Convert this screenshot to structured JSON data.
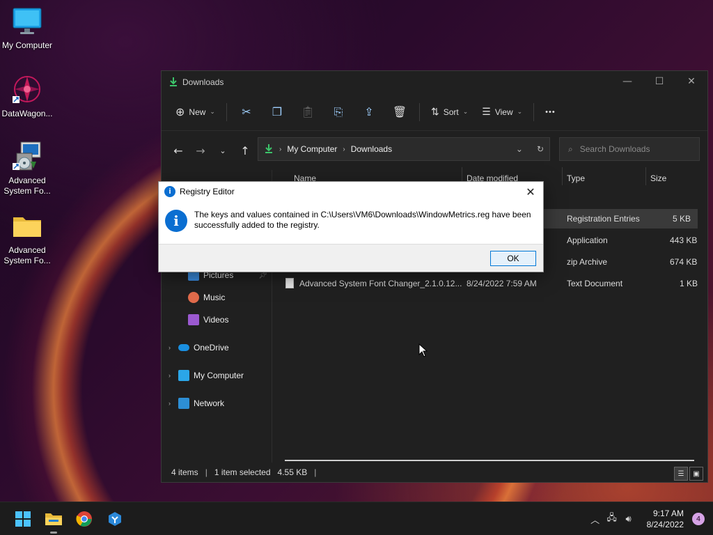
{
  "desktop": {
    "icons": [
      {
        "label": "My Computer"
      },
      {
        "label": "DataWagon..."
      },
      {
        "label": "Advanced System Fo..."
      },
      {
        "label": "Advanced System Fo..."
      }
    ]
  },
  "explorer": {
    "title": "Downloads",
    "toolbar": {
      "new_label": "New",
      "sort_label": "Sort",
      "view_label": "View",
      "more_label": "•••"
    },
    "address": {
      "crumbs": [
        "My Computer",
        "Downloads"
      ]
    },
    "search": {
      "placeholder": "Search Downloads"
    },
    "sidebar": {
      "items": [
        {
          "label": "Pictures",
          "icon": "pictures-icon"
        },
        {
          "label": "Music",
          "icon": "music-icon"
        },
        {
          "label": "Videos",
          "icon": "videos-icon"
        },
        {
          "label": "OneDrive",
          "icon": "onedrive-icon"
        },
        {
          "label": "My Computer",
          "icon": "computer-icon"
        },
        {
          "label": "Network",
          "icon": "network-icon"
        }
      ]
    },
    "columns": {
      "name": "Name",
      "date": "Date modified",
      "type": "Type",
      "size": "Size"
    },
    "files": [
      {
        "name": "",
        "date": "",
        "type": "Registration Entries",
        "size": "5 KB"
      },
      {
        "name": "",
        "date": "",
        "type": "Application",
        "size": "443 KB"
      },
      {
        "name": "",
        "date": "",
        "type": "zip Archive",
        "size": "674 KB"
      },
      {
        "name": "Advanced System Font Changer_2.1.0.12...",
        "date": "8/24/2022 7:59 AM",
        "type": "Text Document",
        "size": "1 KB"
      }
    ],
    "status": {
      "items": "4 items",
      "selected": "1 item selected",
      "size": "4.55 KB"
    }
  },
  "dialog": {
    "title": "Registry Editor",
    "message": "The keys and values contained in C:\\Users\\VM6\\Downloads\\WindowMetrics.reg have been successfully added to the registry.",
    "ok_label": "OK"
  },
  "taskbar": {
    "apps": [
      "start-icon",
      "file-explorer-icon",
      "chrome-icon",
      "app-icon"
    ],
    "time": "9:17 AM",
    "date": "8/24/2022",
    "notifications": "4"
  },
  "colors": {
    "accent": "#0078d7",
    "info_blue": "#0a6ed1",
    "window_bg": "#202020",
    "download_green": "#3cc46a"
  }
}
